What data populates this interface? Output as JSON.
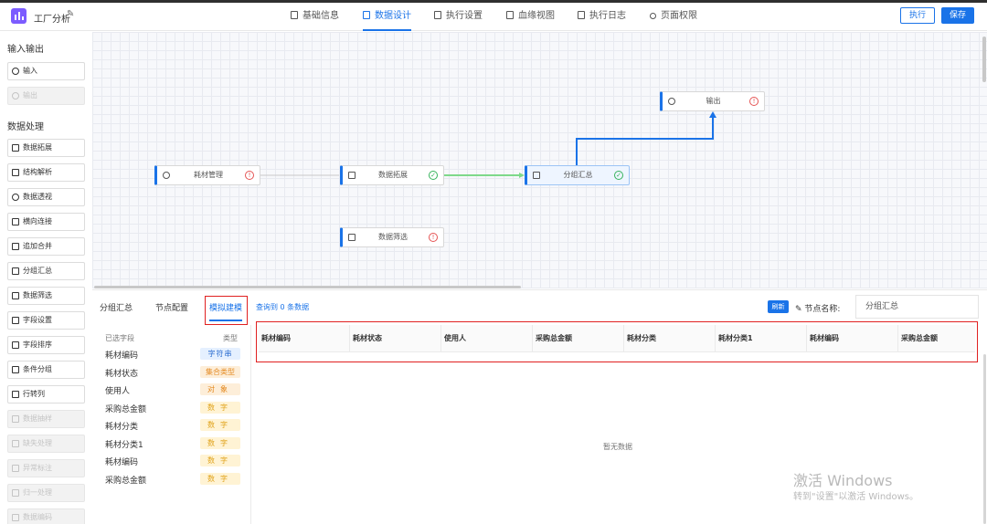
{
  "header": {
    "app_title": "工厂分析",
    "tabs": [
      {
        "label": "基础信息",
        "active": false
      },
      {
        "label": "数据设计",
        "active": true
      },
      {
        "label": "执行设置",
        "active": false
      },
      {
        "label": "血缘视图",
        "active": false
      },
      {
        "label": "执行日志",
        "active": false
      },
      {
        "label": "页面权限",
        "active": false
      }
    ],
    "run_label": "执行",
    "save_label": "保存",
    "accent_color": "#1a73e8"
  },
  "sidebar": {
    "section_io": "输入输出",
    "io_items": [
      {
        "label": "输入",
        "icon": "play-circle-icon",
        "disabled": false
      },
      {
        "label": "输出",
        "icon": "pause-circle-icon",
        "disabled": true
      }
    ],
    "section_processing": "数据处理",
    "processing_items": [
      {
        "label": "数据拓展",
        "icon": "copy-icon",
        "disabled": false
      },
      {
        "label": "结构解析",
        "icon": "sliders-icon",
        "disabled": false
      },
      {
        "label": "数据透视",
        "icon": "eye-icon",
        "disabled": false
      },
      {
        "label": "横向连接",
        "icon": "move-icon",
        "disabled": false
      },
      {
        "label": "追加合并",
        "icon": "calendar-icon",
        "disabled": false
      },
      {
        "label": "分组汇总",
        "icon": "document-icon",
        "disabled": false
      },
      {
        "label": "数据筛选",
        "icon": "filter-doc-icon",
        "disabled": false
      },
      {
        "label": "字段设置",
        "icon": "field-settings-icon",
        "disabled": false
      },
      {
        "label": "字段排序",
        "icon": "sort-icon",
        "disabled": false
      },
      {
        "label": "条件分组",
        "icon": "group-icon",
        "disabled": false
      },
      {
        "label": "行转列",
        "icon": "table-icon",
        "disabled": false
      },
      {
        "label": "数据抽样",
        "icon": "box-icon",
        "disabled": true
      },
      {
        "label": "缺失处理",
        "icon": "box-icon",
        "disabled": true
      },
      {
        "label": "异常标注",
        "icon": "box-icon",
        "disabled": true
      },
      {
        "label": "归一处理",
        "icon": "box-icon",
        "disabled": true
      },
      {
        "label": "数据编码",
        "icon": "box-icon",
        "disabled": true
      }
    ]
  },
  "canvas": {
    "nodes": [
      {
        "id": "n1",
        "label": "耗材管理",
        "icon": "play-circle-icon",
        "status": "warning"
      },
      {
        "id": "n2",
        "label": "数据拓展",
        "icon": "copy-icon",
        "status": "ok"
      },
      {
        "id": "n3",
        "label": "分组汇总",
        "icon": "document-icon",
        "status": "ok"
      },
      {
        "id": "n4",
        "label": "输出",
        "icon": "pause-circle-icon",
        "status": "warning"
      },
      {
        "id": "n5",
        "label": "数据筛选",
        "icon": "filter-doc-icon",
        "status": "warning"
      }
    ],
    "link_colors": {
      "pending": "#c8c8c8",
      "success": "#7ed98a",
      "active": "#1a73e8"
    }
  },
  "panel": {
    "tabs": [
      {
        "label": "分组汇总",
        "active": false
      },
      {
        "label": "节点配置",
        "active": false
      },
      {
        "label": "模拟建模",
        "active": true
      }
    ],
    "query_info": "查询到 0 条数据",
    "refresh_label": "刷新",
    "node_name_label": "节点名称:",
    "node_name_value": "分组汇总",
    "field_list": {
      "header_field": "已选字段",
      "header_type": "类型",
      "fields": [
        {
          "name": "耗材编码",
          "type": "字符串",
          "kind": "str"
        },
        {
          "name": "耗材状态",
          "type": "集合类型",
          "kind": "set"
        },
        {
          "name": "使用人",
          "type": "对象",
          "kind": "obj"
        },
        {
          "name": "采购总金额",
          "type": "数字",
          "kind": "num"
        },
        {
          "name": "耗材分类",
          "type": "数字",
          "kind": "num"
        },
        {
          "name": "耗材分类1",
          "type": "数字",
          "kind": "num"
        },
        {
          "name": "耗材编码",
          "type": "数字",
          "kind": "num"
        },
        {
          "name": "采购总金额",
          "type": "数字",
          "kind": "num"
        }
      ]
    },
    "table": {
      "columns": [
        "耗材编码",
        "耗材状态",
        "使用人",
        "采购总金额",
        "耗材分类",
        "耗材分类1",
        "耗材编码",
        "采购总金额"
      ],
      "empty_text": "暂无数据"
    }
  },
  "watermark": {
    "line1": "激活 Windows",
    "line2": "转到\"设置\"以激活 Windows。"
  }
}
